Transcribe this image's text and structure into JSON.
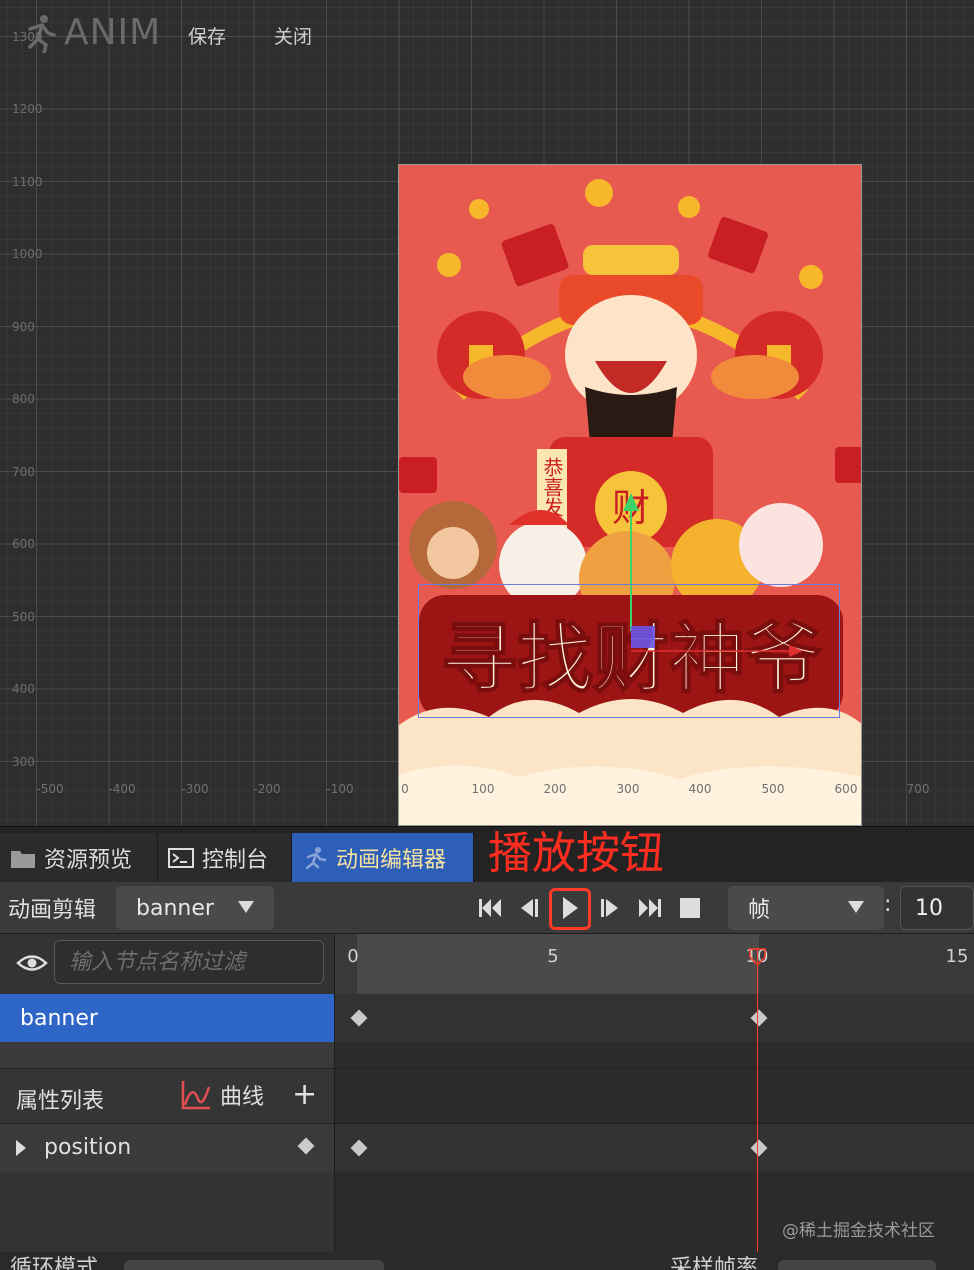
{
  "app": {
    "title": "ANIM",
    "menu": {
      "save": "保存",
      "close": "关闭"
    }
  },
  "scene": {
    "y_ticks": [
      "1300",
      "1200",
      "1100",
      "1000",
      "900",
      "800",
      "700",
      "600",
      "500",
      "400",
      "300"
    ],
    "x_ticks": [
      "-500",
      "-400",
      "-300",
      "-200",
      "-100",
      "0",
      "100",
      "200",
      "300",
      "400",
      "500",
      "600",
      "700"
    ],
    "poster": {
      "title_text": "寻找财神爷",
      "scroll_text": "恭喜发",
      "medallion_text": "财"
    }
  },
  "tabs": [
    {
      "label": "资源预览",
      "icon": "folder-icon"
    },
    {
      "label": "控制台",
      "icon": "terminal-icon"
    },
    {
      "label": "动画编辑器",
      "icon": "run-icon"
    }
  ],
  "annotation": {
    "label": "播放按钮"
  },
  "toolbar": {
    "clip_label": "动画剪辑",
    "clip_value": "banner",
    "unit_value": "帧",
    "colon": ":",
    "frame_value": "10"
  },
  "nodes": {
    "filter_placeholder": "输入节点名称过滤",
    "selected_node": "banner"
  },
  "properties": {
    "title": "属性列表",
    "curve_label": "曲线",
    "add_label": "+",
    "items": [
      {
        "name": "position"
      }
    ]
  },
  "timeline": {
    "ruler_labels": [
      "0",
      "5",
      "10",
      "15"
    ],
    "current_frame": 10,
    "keyframes_frames": [
      0,
      10
    ]
  },
  "footer": {
    "left_label": "循环模式",
    "right_label": "采样帧率"
  },
  "watermark": "@稀土掘金技术社区",
  "colors": {
    "accent_tab": "#2d5fb8",
    "selection_row": "#2e66c8",
    "annotation_red": "#ff2c20",
    "poster_red": "#e85a50"
  }
}
